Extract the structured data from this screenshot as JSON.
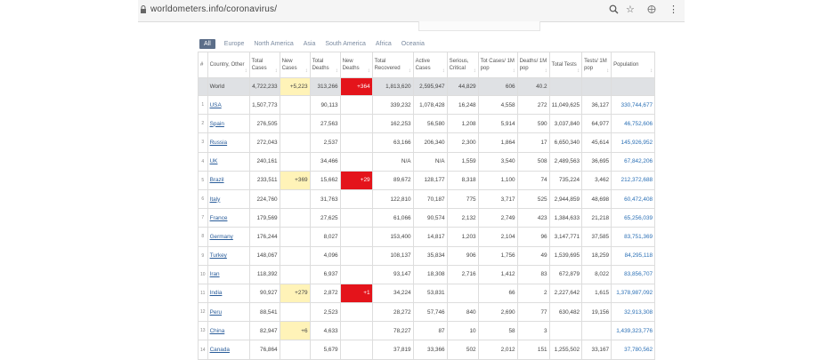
{
  "browser": {
    "url": "worldometers.info/coronavirus/",
    "icons": [
      "lock-icon",
      "search-icon",
      "star-icon",
      "extension-icon",
      "menu-icon"
    ]
  },
  "tabs": [
    "All",
    "Europe",
    "North America",
    "Asia",
    "South America",
    "Africa",
    "Oceania"
  ],
  "columns": [
    "#",
    "Country, Other",
    "Total Cases",
    "New Cases",
    "Total Deaths",
    "New Deaths",
    "Total Recovered",
    "Active Cases",
    "Serious, Critical",
    "Tot Cases/ 1M pop",
    "Deaths/ 1M pop",
    "Total Tests",
    "Tests/ 1M pop",
    "Population"
  ],
  "world": {
    "country": "World",
    "total_cases": "4,722,233",
    "new_cases": "+5,223",
    "total_deaths": "313,266",
    "new_deaths": "+364",
    "recovered": "1,813,620",
    "active": "2,595,947",
    "critical": "44,829",
    "cases_per_m": "606",
    "deaths_per_m": "40.2",
    "tests": "",
    "tests_per_m": "",
    "population": ""
  },
  "rows": [
    {
      "idx": "1",
      "country": "USA",
      "total_cases": "1,507,773",
      "new_cases": "",
      "total_deaths": "90,113",
      "new_deaths": "",
      "recovered": "339,232",
      "active": "1,078,428",
      "critical": "16,248",
      "cases_per_m": "4,558",
      "deaths_per_m": "272",
      "tests": "11,049,625",
      "tests_per_m": "36,127",
      "population": "330,744,677"
    },
    {
      "idx": "2",
      "country": "Spain",
      "total_cases": "276,505",
      "new_cases": "",
      "total_deaths": "27,563",
      "new_deaths": "",
      "recovered": "162,253",
      "active": "56,580",
      "critical": "1,208",
      "cases_per_m": "5,914",
      "deaths_per_m": "590",
      "tests": "3,037,840",
      "tests_per_m": "64,977",
      "population": "46,752,606"
    },
    {
      "idx": "3",
      "country": "Russia",
      "total_cases": "272,043",
      "new_cases": "",
      "total_deaths": "2,537",
      "new_deaths": "",
      "recovered": "63,166",
      "active": "206,340",
      "critical": "2,300",
      "cases_per_m": "1,864",
      "deaths_per_m": "17",
      "tests": "6,650,340",
      "tests_per_m": "45,614",
      "population": "145,926,952"
    },
    {
      "idx": "4",
      "country": "UK",
      "total_cases": "240,161",
      "new_cases": "",
      "total_deaths": "34,466",
      "new_deaths": "",
      "recovered": "N/A",
      "active": "N/A",
      "critical": "1,559",
      "cases_per_m": "3,540",
      "deaths_per_m": "508",
      "tests": "2,489,563",
      "tests_per_m": "36,695",
      "population": "67,842,206"
    },
    {
      "idx": "5",
      "country": "Brazil",
      "total_cases": "233,511",
      "new_cases": "+369",
      "total_deaths": "15,662",
      "new_deaths": "+29",
      "recovered": "89,672",
      "active": "128,177",
      "critical": "8,318",
      "cases_per_m": "1,100",
      "deaths_per_m": "74",
      "tests": "735,224",
      "tests_per_m": "3,462",
      "population": "212,372,688"
    },
    {
      "idx": "6",
      "country": "Italy",
      "total_cases": "224,760",
      "new_cases": "",
      "total_deaths": "31,763",
      "new_deaths": "",
      "recovered": "122,810",
      "active": "70,187",
      "critical": "775",
      "cases_per_m": "3,717",
      "deaths_per_m": "525",
      "tests": "2,944,859",
      "tests_per_m": "48,698",
      "population": "60,472,408"
    },
    {
      "idx": "7",
      "country": "France",
      "total_cases": "179,569",
      "new_cases": "",
      "total_deaths": "27,625",
      "new_deaths": "",
      "recovered": "61,066",
      "active": "90,574",
      "critical": "2,132",
      "cases_per_m": "2,749",
      "deaths_per_m": "423",
      "tests": "1,384,633",
      "tests_per_m": "21,218",
      "population": "65,256,039"
    },
    {
      "idx": "8",
      "country": "Germany",
      "total_cases": "176,244",
      "new_cases": "",
      "total_deaths": "8,027",
      "new_deaths": "",
      "recovered": "153,400",
      "active": "14,817",
      "critical": "1,203",
      "cases_per_m": "2,104",
      "deaths_per_m": "96",
      "tests": "3,147,771",
      "tests_per_m": "37,585",
      "population": "83,751,369"
    },
    {
      "idx": "9",
      "country": "Turkey",
      "total_cases": "148,067",
      "new_cases": "",
      "total_deaths": "4,096",
      "new_deaths": "",
      "recovered": "108,137",
      "active": "35,834",
      "critical": "906",
      "cases_per_m": "1,756",
      "deaths_per_m": "49",
      "tests": "1,539,695",
      "tests_per_m": "18,259",
      "population": "84,295,118"
    },
    {
      "idx": "10",
      "country": "Iran",
      "total_cases": "118,392",
      "new_cases": "",
      "total_deaths": "6,937",
      "new_deaths": "",
      "recovered": "93,147",
      "active": "18,308",
      "critical": "2,716",
      "cases_per_m": "1,412",
      "deaths_per_m": "83",
      "tests": "672,879",
      "tests_per_m": "8,022",
      "population": "83,856,707"
    },
    {
      "idx": "11",
      "country": "India",
      "total_cases": "90,927",
      "new_cases": "+279",
      "total_deaths": "2,872",
      "new_deaths": "+1",
      "recovered": "34,224",
      "active": "53,831",
      "critical": "",
      "cases_per_m": "66",
      "deaths_per_m": "2",
      "tests": "2,227,642",
      "tests_per_m": "1,615",
      "population": "1,378,987,092"
    },
    {
      "idx": "12",
      "country": "Peru",
      "total_cases": "88,541",
      "new_cases": "",
      "total_deaths": "2,523",
      "new_deaths": "",
      "recovered": "28,272",
      "active": "57,746",
      "critical": "840",
      "cases_per_m": "2,690",
      "deaths_per_m": "77",
      "tests": "630,482",
      "tests_per_m": "19,156",
      "population": "32,913,308"
    },
    {
      "idx": "13",
      "country": "China",
      "total_cases": "82,947",
      "new_cases": "+6",
      "total_deaths": "4,633",
      "new_deaths": "",
      "recovered": "78,227",
      "active": "87",
      "critical": "10",
      "cases_per_m": "58",
      "deaths_per_m": "3",
      "tests": "",
      "tests_per_m": "",
      "population": "1,439,323,776"
    },
    {
      "idx": "14",
      "country": "Canada",
      "total_cases": "76,864",
      "new_cases": "",
      "total_deaths": "5,679",
      "new_deaths": "",
      "recovered": "37,819",
      "active": "33,366",
      "critical": "502",
      "cases_per_m": "2,012",
      "deaths_per_m": "151",
      "tests": "1,255,502",
      "tests_per_m": "33,167",
      "population": "37,780,562"
    }
  ]
}
